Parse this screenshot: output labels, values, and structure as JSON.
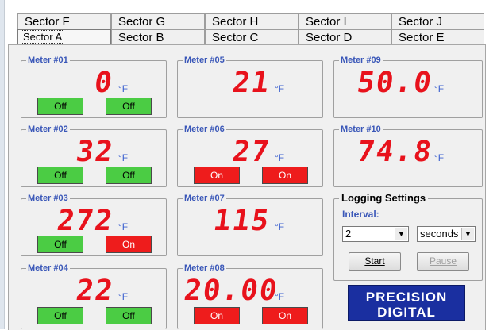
{
  "tabs_back": [
    "Sector F",
    "Sector G",
    "Sector H",
    "Sector I",
    "Sector J"
  ],
  "tabs_front": [
    "Sector A",
    "Sector B",
    "Sector C",
    "Sector D",
    "Sector E"
  ],
  "selected_tab": "Sector A",
  "meters": {
    "m1": {
      "title": "Meter #01",
      "value": "0",
      "unit": "°F",
      "btn1": "Off",
      "btn2": "Off"
    },
    "m2": {
      "title": "Meter #02",
      "value": "32",
      "unit": "°F",
      "btn1": "Off",
      "btn2": "Off"
    },
    "m3": {
      "title": "Meter #03",
      "value": "272",
      "unit": "°F",
      "btn1": "Off",
      "btn2": "On"
    },
    "m4": {
      "title": "Meter #04",
      "value": "22",
      "unit": "°F",
      "btn1": "Off",
      "btn2": "Off"
    },
    "m5": {
      "title": "Meter #05",
      "value": "21",
      "unit": "°F"
    },
    "m6": {
      "title": "Meter #06",
      "value": "27",
      "unit": "°F",
      "btn1": "On",
      "btn2": "On"
    },
    "m7": {
      "title": "Meter #07",
      "value": "115",
      "unit": "°F"
    },
    "m8": {
      "title": "Meter #08",
      "value": "20.00",
      "unit": "°F",
      "btn1": "On",
      "btn2": "On"
    },
    "m9": {
      "title": "Meter #09",
      "value": "50.0",
      "unit": "°F"
    },
    "m10": {
      "title": "Meter #10",
      "value": "74.8",
      "unit": "°F"
    }
  },
  "logging": {
    "title": "Logging Settings",
    "interval_label": "Interval:",
    "interval_value": "2",
    "unit_value": "seconds",
    "start_label": "Start",
    "pause_label": "Pause"
  },
  "logo": {
    "line1": "PRECISION",
    "line2": "DIGITAL"
  },
  "colors": {
    "off": "#4bcc44",
    "on": "#ee1c1c",
    "digits": "#e8121c",
    "label_blue": "#3a57b8",
    "logo_bg": "#1a2fa0"
  }
}
